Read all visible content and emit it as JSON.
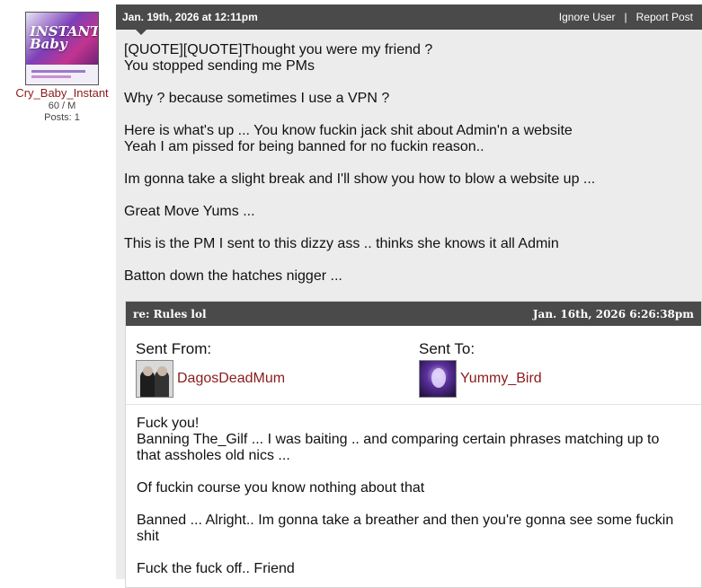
{
  "user": {
    "name": "Cry_Baby_Instant",
    "stats": "60 / M",
    "posts": "Posts: 1",
    "avatar_text": "INSTANT Baby"
  },
  "post": {
    "date": "Jan. 19th, 2026 at 12:11pm",
    "ignore_label": "Ignore User",
    "separator": "|",
    "report_label": "Report Post",
    "paragraphs": [
      [
        "[QUOTE][QUOTE]Thought you were my friend ?",
        "You stopped sending me PMs"
      ],
      [
        "Why ? because sometimes I use a VPN ?"
      ],
      [
        "Here is what's up ... You know fuckin jack shit about Admin'n a website",
        "Yeah I am pissed for being banned for no fuckin reason.."
      ],
      [
        "Im gonna take a slight break and I'll show you how to blow a website up ..."
      ],
      [
        "Great Move Yums ..."
      ],
      [
        "This is the PM I sent to this dizzy ass .. thinks she knows it all Admin"
      ],
      [
        "Batton down the hatches nigger ..."
      ]
    ]
  },
  "pm": {
    "subject": "re: Rules lol",
    "date": "Jan. 16th, 2026 6:26:38pm",
    "sent_from_label": "Sent From:",
    "sent_to_label": "Sent To:",
    "from_user": "DagosDeadMum",
    "to_user": "Yummy_Bird",
    "paragraphs": [
      [
        "Fuck you!",
        "Banning The_Gilf ... I was baiting .. and comparing certain phrases matching up to that assholes old nics ..."
      ],
      [
        "Of fuckin course you know nothing about that"
      ],
      [
        "Banned ... Alright.. Im gonna take a breather and then you're gonna see some fuckin shit"
      ],
      [
        "Fuck the fuck off.. Friend"
      ]
    ]
  },
  "colors": {
    "header_bg": "#4a4a4a",
    "post_bg": "#ececec",
    "username_link": "#8b1a1a"
  }
}
